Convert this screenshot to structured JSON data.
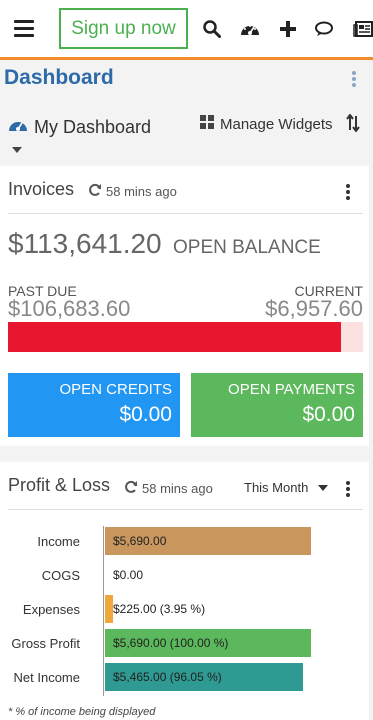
{
  "header": {
    "signup_label": "Sign up now",
    "icons": [
      "menu-icon",
      "search-icon",
      "dashboard-icon",
      "plus-icon",
      "chat-icon",
      "news-icon"
    ],
    "accent": "#f08c2c"
  },
  "page": {
    "title": "Dashboard"
  },
  "dashboard": {
    "name": "My Dashboard",
    "manage_label": "Manage Widgets"
  },
  "invoices": {
    "title": "Invoices",
    "refreshed": "58 mins ago",
    "open_balance": "$113,641.20",
    "open_balance_label": "OPEN BALANCE",
    "past_due_label": "PAST DUE",
    "past_due": "$106,683.60",
    "current_label": "CURRENT",
    "current": "$6,957.60",
    "past_due_fraction": 0.939,
    "bar_color": "#e8162f",
    "open_credits_label": "OPEN CREDITS",
    "open_credits": "$0.00",
    "open_payments_label": "OPEN PAYMENTS",
    "open_payments": "$0.00",
    "credits_color": "#2196f3",
    "payments_color": "#5cb85c"
  },
  "profit_loss": {
    "title": "Profit & Loss",
    "refreshed": "58 mins ago",
    "period": "This Month",
    "footnote": "* % of income being displayed"
  },
  "chart_data": {
    "type": "bar",
    "orientation": "horizontal",
    "categories": [
      "Income",
      "COGS",
      "Expenses",
      "Gross Profit",
      "Net Income"
    ],
    "values": [
      5690.0,
      0.0,
      225.0,
      5690.0,
      5465.0
    ],
    "labels": [
      "$5,690.00",
      "$0.00",
      "$225.00 (3.95 %)",
      "$5,690.00 (100.00 %)",
      "$5,465.00 (96.05 %)"
    ],
    "colors": [
      "#c9975e",
      "#cccccc",
      "#f0a83a",
      "#5cb85c",
      "#2e9a91"
    ],
    "xlim": [
      0,
      5690
    ]
  }
}
